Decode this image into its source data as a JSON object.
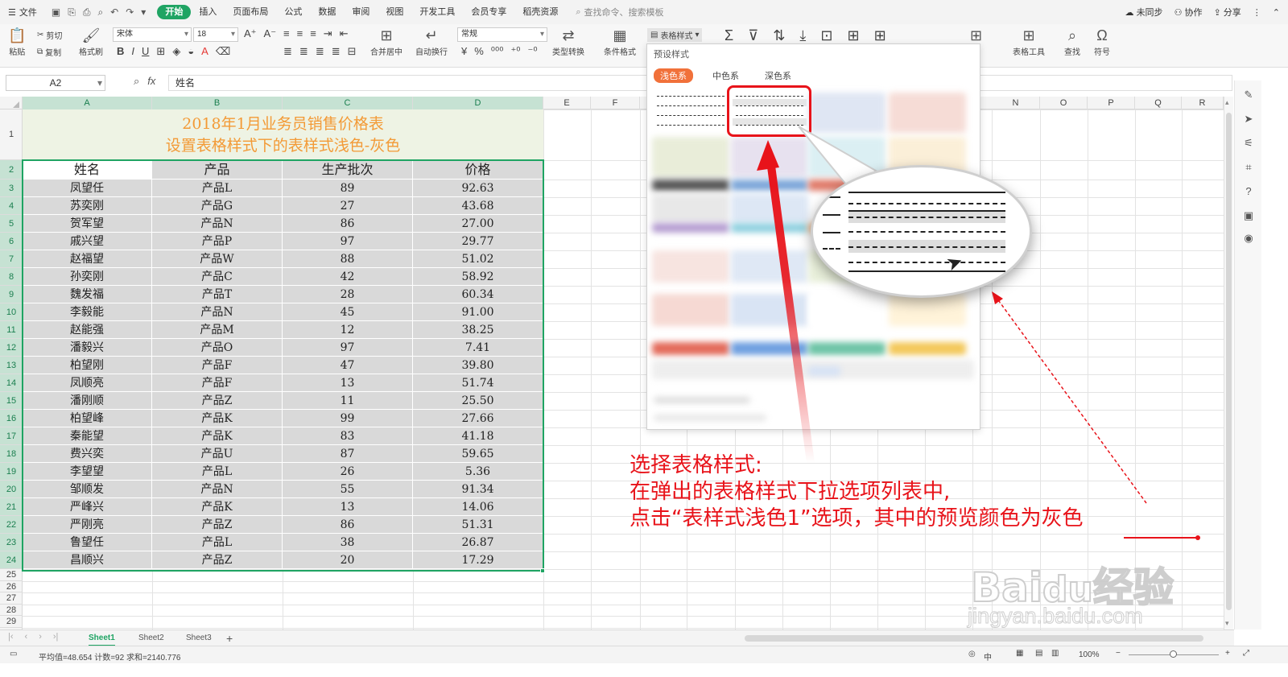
{
  "topbar": {
    "file_label": "文件",
    "tabs": [
      "开始",
      "插入",
      "页面布局",
      "公式",
      "数据",
      "审阅",
      "视图",
      "开发工具",
      "会员专享",
      "稻壳资源"
    ],
    "search_placeholder": "查找命令、搜索模板",
    "right": [
      "未同步",
      "协作",
      "分享"
    ]
  },
  "ribbon": {
    "paste": "粘贴",
    "cut": "剪切",
    "copy": "复制",
    "format_painter": "格式刷",
    "font_name": "宋体",
    "font_size": "18",
    "merge": "合并居中",
    "wrap": "自动换行",
    "number_format": "常规",
    "convert": "类型转换",
    "conditional": "条件格式",
    "table_style": "表格样式",
    "table_tools": "表格工具",
    "find": "查找",
    "symbol": "符号",
    "partial": "格"
  },
  "formula_bar": {
    "cell_ref": "A2",
    "value": "姓名"
  },
  "columns": [
    "A",
    "B",
    "C",
    "D",
    "E",
    "F",
    "N",
    "O",
    "P",
    "Q",
    "R"
  ],
  "sheet": {
    "title_line1": "2018年1月业务员销售价格表",
    "title_line2": "设置表格样式下的表样式浅色-灰色",
    "headers": [
      "姓名",
      "产品",
      "生产批次",
      "价格"
    ],
    "rows": [
      [
        "凤望任",
        "产品L",
        "89",
        "92.63"
      ],
      [
        "苏奕刚",
        "产品G",
        "27",
        "43.68"
      ],
      [
        "贺军望",
        "产品N",
        "86",
        "27.00"
      ],
      [
        "戚兴望",
        "产品P",
        "97",
        "29.77"
      ],
      [
        "赵福望",
        "产品W",
        "88",
        "51.02"
      ],
      [
        "孙奕刚",
        "产品C",
        "42",
        "58.92"
      ],
      [
        "魏发福",
        "产品T",
        "28",
        "60.34"
      ],
      [
        "李毅能",
        "产品N",
        "45",
        "91.00"
      ],
      [
        "赵能强",
        "产品M",
        "12",
        "38.25"
      ],
      [
        "潘毅兴",
        "产品O",
        "97",
        "7.41"
      ],
      [
        "柏望刚",
        "产品F",
        "47",
        "39.80"
      ],
      [
        "凤顺亮",
        "产品F",
        "13",
        "51.74"
      ],
      [
        "潘刚顺",
        "产品Z",
        "11",
        "25.50"
      ],
      [
        "柏望峰",
        "产品K",
        "99",
        "27.66"
      ],
      [
        "秦能望",
        "产品K",
        "83",
        "41.18"
      ],
      [
        "费兴奕",
        "产品U",
        "87",
        "59.65"
      ],
      [
        "李望望",
        "产品L",
        "26",
        "5.36"
      ],
      [
        "邹顺发",
        "产品N",
        "55",
        "91.34"
      ],
      [
        "严峰兴",
        "产品K",
        "13",
        "14.06"
      ],
      [
        "严刚亮",
        "产品Z",
        "86",
        "51.31"
      ],
      [
        "鲁望任",
        "产品L",
        "38",
        "26.87"
      ],
      [
        "昌顺兴",
        "产品Z",
        "20",
        "17.29"
      ]
    ]
  },
  "row_numbers": [
    "1",
    "2",
    "3",
    "4",
    "5",
    "6",
    "7",
    "8",
    "9",
    "10",
    "11",
    "12",
    "13",
    "14",
    "15",
    "16",
    "17",
    "18",
    "19",
    "20",
    "21",
    "22",
    "23",
    "24",
    "25",
    "26",
    "27",
    "28",
    "29"
  ],
  "panel": {
    "title": "预设样式",
    "tabs": [
      "浅色系",
      "中色系",
      "深色系"
    ]
  },
  "annotation": {
    "line1": "选择表格样式:",
    "line2": "在弹出的表格样式下拉选项列表中,",
    "line3_pre": "点击“表样式浅色1”选项，其中的预览颜色为",
    "line3_hl": "灰色"
  },
  "sheet_tabs": [
    "Sheet1",
    "Sheet2",
    "Sheet3"
  ],
  "status": {
    "summary": "平均值=48.654  计数=92  求和=2140.776",
    "zoom": "100%",
    "lang": "中"
  },
  "watermark": {
    "brand": "Bai",
    "brand2": "经验",
    "url": "jingyan.baidu.com"
  },
  "colors": {
    "accent_green": "#1fa463",
    "title_orange": "#f39a36",
    "annot_red": "#e8131a",
    "tab_orange": "#f1713a"
  }
}
